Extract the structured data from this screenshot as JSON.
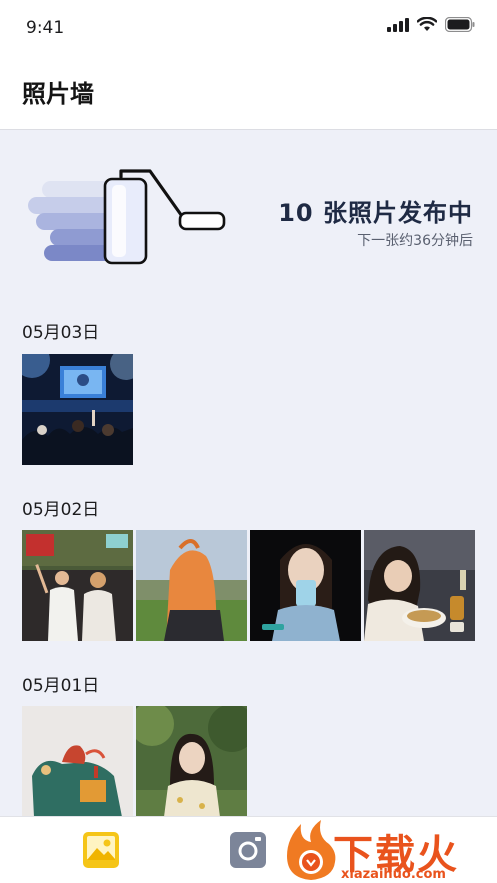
{
  "status": {
    "time": "9:41"
  },
  "header": {
    "title": "照片墙"
  },
  "banner": {
    "title": "10 张照片发布中",
    "subtitle": "下一张约36分钟后",
    "illustration_icon": "paint-roller-icon"
  },
  "groups": [
    {
      "date": "05月03日",
      "photos": [
        "concert-stage-photo"
      ]
    },
    {
      "date": "05月02日",
      "photos": [
        "festival-friends-photo",
        "orange-hair-lawn-photo",
        "drink-can-portrait-photo",
        "noodle-bowl-photo"
      ]
    },
    {
      "date": "05月01日",
      "photos": [
        "sculpture-photo",
        "garden-portrait-photo"
      ]
    }
  ],
  "tabbar": {
    "items": [
      {
        "icon": "photo-wall-icon",
        "active": true,
        "color": "#f5c518"
      },
      {
        "icon": "camera-icon",
        "active": false,
        "color": "#7c8599"
      }
    ]
  },
  "watermark": {
    "text": "下载火",
    "url": "xiazaihuo.com"
  },
  "colors": {
    "background": "#eef0f8",
    "accent": "#f5c518",
    "watermark": "#e9531d"
  }
}
